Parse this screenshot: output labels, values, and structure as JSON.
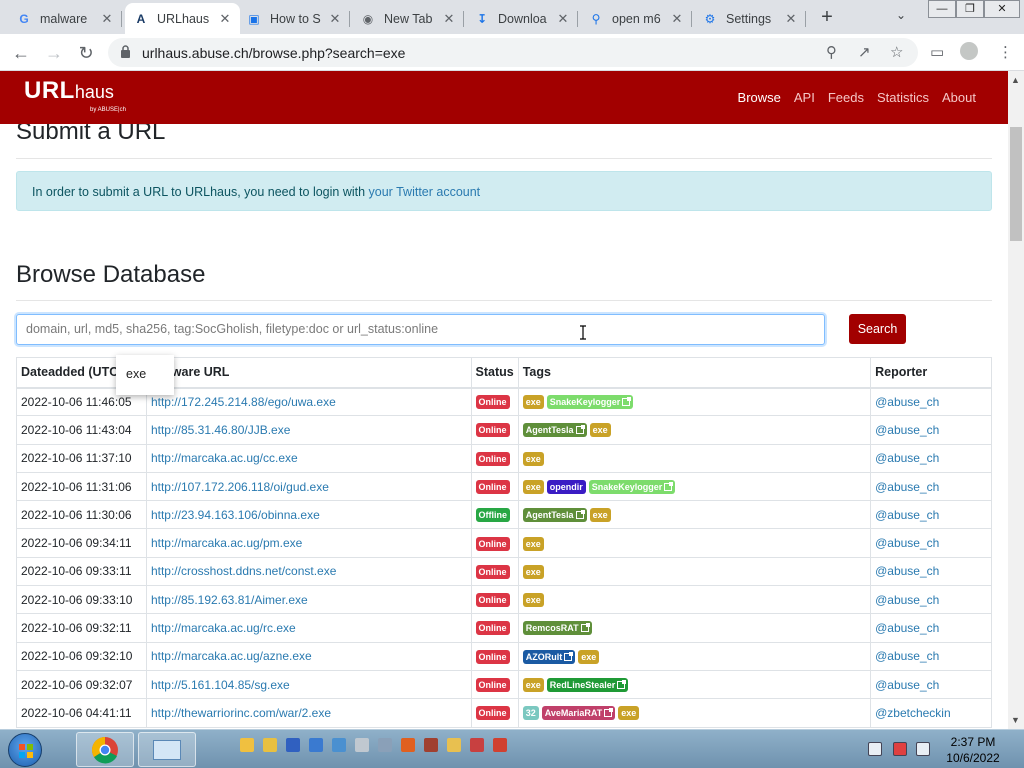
{
  "browser": {
    "tabs": [
      {
        "title": "malware",
        "favicon": "G",
        "color": "#4285f4"
      },
      {
        "title": "URLhaus",
        "favicon": "A",
        "color": "#1a3b66",
        "active": true
      },
      {
        "title": "How to S",
        "favicon": "doc-icon",
        "color": "#1a73e8"
      },
      {
        "title": "New Tab",
        "favicon": "chrome-icon",
        "color": "#5f6368"
      },
      {
        "title": "Downloa",
        "favicon": "download-icon",
        "color": "#1a73e8"
      },
      {
        "title": "open m6",
        "favicon": "search-icon",
        "color": "#1a73e8"
      },
      {
        "title": "Settings",
        "favicon": "gear-icon",
        "color": "#1a73e8"
      }
    ],
    "url": "urlhaus.abuse.ch/browse.php?search=exe"
  },
  "site": {
    "brand_main": "URL",
    "brand_sub": "haus",
    "brand_by": "by ABUSE|ch",
    "nav": [
      "Browse",
      "API",
      "Feeds",
      "Statistics",
      "About"
    ],
    "active_nav": "Browse"
  },
  "submit": {
    "heading": "Submit a URL",
    "notice_prefix": "In order to submit a URL to URLhaus, you need to login with ",
    "notice_link": "your Twitter account"
  },
  "browse": {
    "heading": "Browse Database",
    "search_placeholder": "domain, url, md5, sha256, tag:SocGholish, filetype:doc or url_status:online",
    "search_button": "Search",
    "autocomplete": "exe"
  },
  "table": {
    "columns": [
      "Dateadded (UTC)",
      "Malware URL",
      "Status",
      "Tags",
      "Reporter"
    ],
    "rows": [
      {
        "date": "2022-10-06 11:46:05",
        "url": "http://172.245.214.88/ego/uwa.exe",
        "status": "Online",
        "tags": [
          {
            "t": "exe",
            "c": "#c9a227"
          },
          {
            "t": "SnakeKeylogger",
            "c": "#7ddc6c",
            "ext": true
          }
        ],
        "reporter": "@abuse_ch"
      },
      {
        "date": "2022-10-06 11:43:04",
        "url": "http://85.31.46.80/JJB.exe",
        "status": "Online",
        "tags": [
          {
            "t": "AgentTesla",
            "c": "#5f8f3a",
            "ext": true
          },
          {
            "t": "exe",
            "c": "#c9a227"
          }
        ],
        "reporter": "@abuse_ch"
      },
      {
        "date": "2022-10-06 11:37:10",
        "url": "http://marcaka.ac.ug/cc.exe",
        "status": "Online",
        "tags": [
          {
            "t": "exe",
            "c": "#c9a227"
          }
        ],
        "reporter": "@abuse_ch"
      },
      {
        "date": "2022-10-06 11:31:06",
        "url": "http://107.172.206.118/oi/gud.exe",
        "status": "Online",
        "tags": [
          {
            "t": "exe",
            "c": "#c9a227"
          },
          {
            "t": "opendir",
            "c": "#3a1cc4"
          },
          {
            "t": "SnakeKeylogger",
            "c": "#7ddc6c",
            "ext": true
          }
        ],
        "reporter": "@abuse_ch"
      },
      {
        "date": "2022-10-06 11:30:06",
        "url": "http://23.94.163.106/obinna.exe",
        "status": "Offline",
        "tags": [
          {
            "t": "AgentTesla",
            "c": "#5f8f3a",
            "ext": true
          },
          {
            "t": "exe",
            "c": "#c9a227"
          }
        ],
        "reporter": "@abuse_ch"
      },
      {
        "date": "2022-10-06 09:34:11",
        "url": "http://marcaka.ac.ug/pm.exe",
        "status": "Online",
        "tags": [
          {
            "t": "exe",
            "c": "#c9a227"
          }
        ],
        "reporter": "@abuse_ch"
      },
      {
        "date": "2022-10-06 09:33:11",
        "url": "http://crosshost.ddns.net/const.exe",
        "status": "Online",
        "tags": [
          {
            "t": "exe",
            "c": "#c9a227"
          }
        ],
        "reporter": "@abuse_ch"
      },
      {
        "date": "2022-10-06 09:33:10",
        "url": "http://85.192.63.81/Aimer.exe",
        "status": "Online",
        "tags": [
          {
            "t": "exe",
            "c": "#c9a227"
          }
        ],
        "reporter": "@abuse_ch"
      },
      {
        "date": "2022-10-06 09:32:11",
        "url": "http://marcaka.ac.ug/rc.exe",
        "status": "Online",
        "tags": [
          {
            "t": "RemcosRAT",
            "c": "#5f8f3a",
            "ext": true
          }
        ],
        "reporter": "@abuse_ch"
      },
      {
        "date": "2022-10-06 09:32:10",
        "url": "http://marcaka.ac.ug/azne.exe",
        "status": "Online",
        "tags": [
          {
            "t": "AZORult",
            "c": "#1a5aa3",
            "ext": true
          },
          {
            "t": "exe",
            "c": "#c9a227"
          }
        ],
        "reporter": "@abuse_ch"
      },
      {
        "date": "2022-10-06 09:32:07",
        "url": "http://5.161.104.85/sg.exe",
        "status": "Online",
        "tags": [
          {
            "t": "exe",
            "c": "#c9a227"
          },
          {
            "t": "RedLineStealer",
            "c": "#1f9a36",
            "ext": true
          }
        ],
        "reporter": "@abuse_ch"
      },
      {
        "date": "2022-10-06 04:41:11",
        "url": "http://thewarriorinc.com/war/2.exe",
        "status": "Online",
        "tags": [
          {
            "t": "32",
            "c": "#7bc8c0"
          },
          {
            "t": "AveMariaRAT",
            "c": "#c0406a",
            "ext": true
          },
          {
            "t": "exe",
            "c": "#c9a227"
          }
        ],
        "reporter": "@zbetcheckin"
      }
    ]
  },
  "taskbar": {
    "time": "2:37 PM",
    "date": "10/6/2022"
  },
  "colors": {
    "brand_red": "#a20000",
    "link_blue": "#2a7ab0",
    "online_red": "#dc3545",
    "offline_green": "#28a745"
  }
}
